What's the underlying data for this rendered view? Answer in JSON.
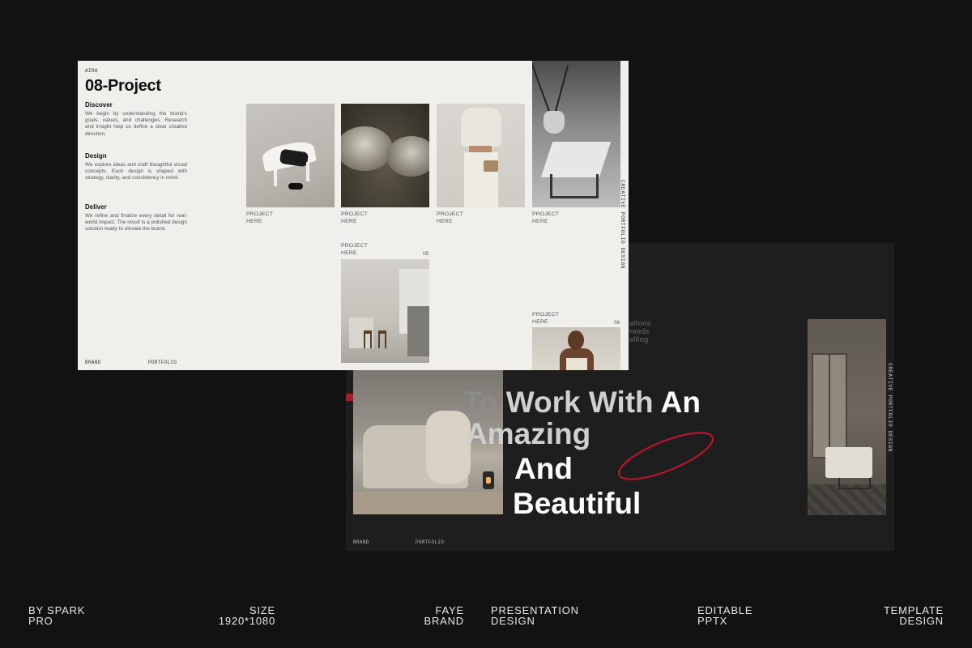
{
  "light_slide": {
    "brand_mark": "AIRA",
    "title": "08-Project",
    "sections": [
      {
        "heading": "Discover",
        "body": "We begin by understanding the brand's goals, values, and challenges. Research and insight help us define a clear creative direction."
      },
      {
        "heading": "Design",
        "body": "We explore ideas and craft thoughtful visual concepts. Each design is shaped with strategy, clarity, and consistency in mind."
      },
      {
        "heading": "Deliver",
        "body": "We refine and finalize every detail for real-world impact. The result is a polished design solution ready to elevate the brand."
      }
    ],
    "projects": [
      {
        "line1": "PROJECT",
        "line2": "HERE",
        "number": ""
      },
      {
        "line1": "PROJECT",
        "line2": "HERE",
        "number": ""
      },
      {
        "line1": "PROJECT",
        "line2": "HERE",
        "number": ""
      },
      {
        "line1": "PROJECT",
        "line2": "HERE",
        "number": ""
      },
      {
        "line1": "PROJECT",
        "line2": "HERE",
        "number": "05"
      },
      {
        "line1": "PROJECT",
        "line2": "HERE",
        "number": "06"
      }
    ],
    "footer_left": "BRAND",
    "footer_right": "PORTFOLIO",
    "vertical_label": "CREATIVE PORTFOLIO DESIGN"
  },
  "dark_slide": {
    "faint_lines": [
      "ations",
      "rands",
      "elling"
    ],
    "heading": {
      "line1_part1": "To",
      "line1_part2": "Work With",
      "line1_part3": "An",
      "line2": "Amazing",
      "line3": "And",
      "line4": "Beautiful"
    },
    "footer_left": "BRAND",
    "footer_right": "PORTFOLIO",
    "vertical_label": "CREATIVE PORTFOLIO DESIGN",
    "accent_color": "#b0182a"
  },
  "meta": [
    {
      "line1": "BY SPARK",
      "line2": "PRO"
    },
    {
      "line1": "SIZE",
      "line2": "1920*1080"
    },
    {
      "line1": "FAYE",
      "line2": "BRAND"
    },
    {
      "line1": "PRESENTATION",
      "line2": "DESIGN"
    },
    {
      "line1": "EDITABLE",
      "line2": "PPTX"
    },
    {
      "line1": "TEMPLATE",
      "line2": "DESIGN"
    }
  ]
}
